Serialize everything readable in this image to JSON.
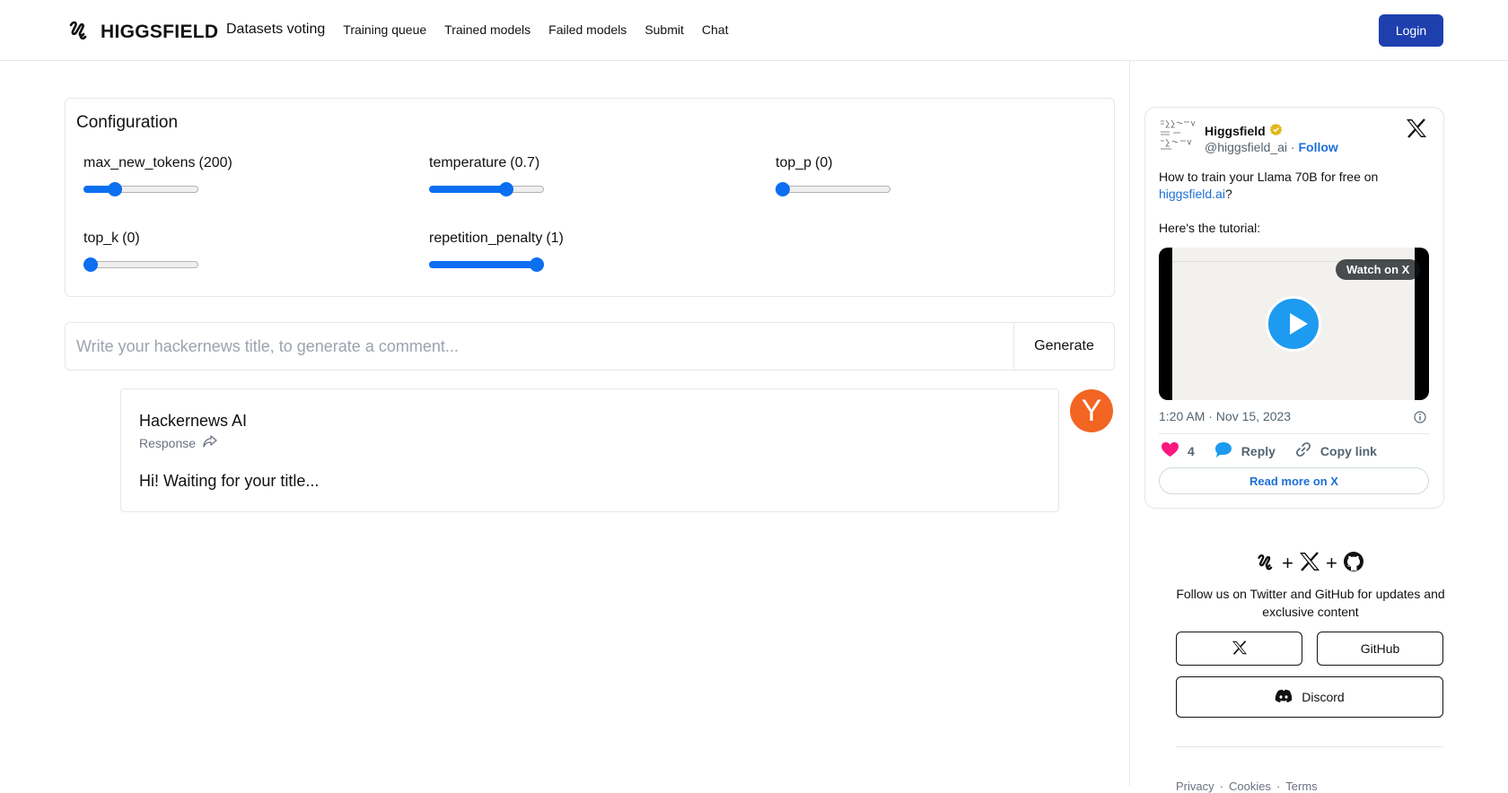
{
  "header": {
    "brand": "HIGGSFIELD",
    "nav": [
      "Datasets voting",
      "Training queue",
      "Trained models",
      "Failed models",
      "Submit",
      "Chat"
    ],
    "login_label": "Login",
    "accent": "#1e40af"
  },
  "config": {
    "title": "Configuration",
    "params": [
      {
        "name": "max_new_tokens",
        "value": "(200)",
        "level": 0.24
      },
      {
        "name": "temperature",
        "value": "(0.7)",
        "level": 0.7
      },
      {
        "name": "top_p",
        "value": "(0)",
        "level": 0
      },
      {
        "name": "top_k",
        "value": "(0)",
        "level": 0
      },
      {
        "name": "repetition_penalty",
        "value": "(1)",
        "level": 1
      }
    ],
    "slider_color": "#0b6ff0"
  },
  "prompt": {
    "placeholder": "Write your hackernews title, to generate a comment...",
    "value": "",
    "generate_label": "Generate"
  },
  "message": {
    "author": "Hackernews AI",
    "subtitle": "Response",
    "text": "Hi! Waiting for your title...",
    "avatar_letter": "Y",
    "avatar_color": "#f26522"
  },
  "tweet": {
    "name": "Higgsfield",
    "handle": "@higgsfield_ai",
    "follow": "Follow",
    "body_prefix": "How to train  your Llama 70B for free on",
    "body_link": "higgsfield.ai",
    "body_suffix": "?",
    "body2": "Here's the tutorial:",
    "watch": "Watch on X",
    "date": "1:20 AM · Nov 15, 2023",
    "likes": "4",
    "reply": "Reply",
    "copy": "Copy link",
    "read_more": "Read more on X"
  },
  "social": {
    "text": "Follow us on Twitter and GitHub for updates and exclusive content",
    "github": "GitHub",
    "discord": "Discord"
  },
  "footer": [
    "Privacy",
    "Cookies",
    "Terms"
  ]
}
